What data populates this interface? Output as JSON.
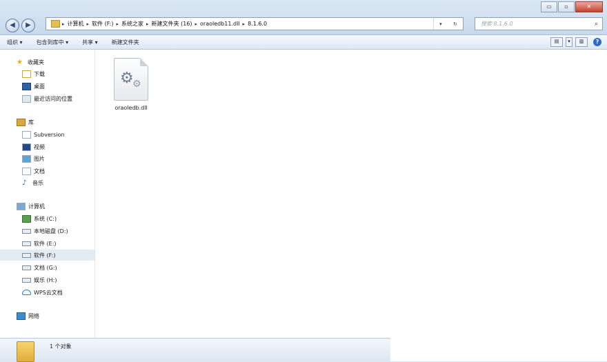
{
  "window": {
    "controls": {
      "minimize": "▭",
      "maximize": "▫",
      "close": "✕"
    }
  },
  "nav": {
    "back_icon": "arrow-left-icon",
    "forward_icon": "arrow-right-icon",
    "back": "◀",
    "forward": "▶"
  },
  "address": {
    "breadcrumbs": [
      "计算机",
      "软件 (F:)",
      "系统之家",
      "新建文件夹 (16)",
      "oraoledb11.dll",
      "8.1.6.0"
    ],
    "dropdown": "▾",
    "refresh": "↻"
  },
  "search": {
    "placeholder": "搜索 8.1.6.0",
    "icon": "⌕"
  },
  "toolbar": {
    "organize": "组织 ▾",
    "include_in_library": "包含到库中 ▾",
    "share": "共享 ▾",
    "new_folder": "新建文件夹",
    "help": "?"
  },
  "sidebar": {
    "favorites": {
      "label": "收藏夹",
      "items": [
        "下载",
        "桌面",
        "最近访问的位置"
      ]
    },
    "libraries": {
      "label": "库",
      "items": [
        "Subversion",
        "视频",
        "图片",
        "文档",
        "音乐"
      ]
    },
    "computer": {
      "label": "计算机",
      "items": [
        "系统 (C:)",
        "本地磁盘 (D:)",
        "软件 (E:)",
        "软件 (F:)",
        "文档 (G:)",
        "娱乐 (H:)",
        "WPS云文档"
      ]
    },
    "network": {
      "label": "网络"
    }
  },
  "content": {
    "files": [
      {
        "name": "oraoledb.dll",
        "icon": "gear-file-icon"
      }
    ]
  },
  "status": {
    "count_text": "1 个对象"
  }
}
